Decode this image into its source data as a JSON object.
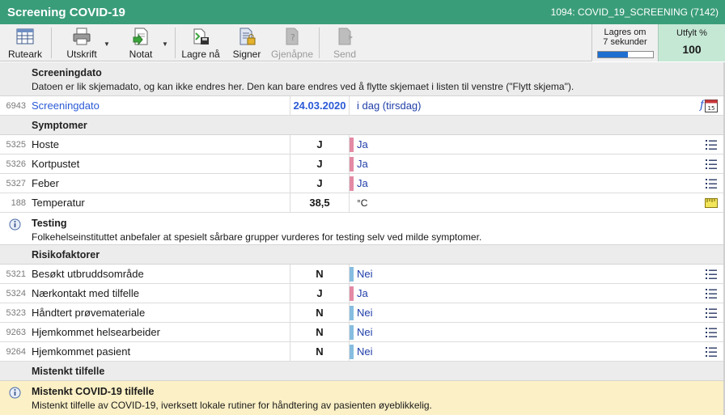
{
  "titlebar": {
    "title": "Screening COVID-19",
    "doc_id": "1094: COVID_19_SCREENING (7142)"
  },
  "toolbar": {
    "ruteark": "Ruteark",
    "utskrift": "Utskrift",
    "notat": "Notat",
    "lagre": "Lagre nå",
    "signer": "Signer",
    "gjenapne": "Gjenåpne",
    "send": "Send",
    "save_status": "Lagres om 7 sekunder",
    "save_progress": 0.55,
    "fill_label": "Utfylt %",
    "fill_value": "100"
  },
  "screeningdato": {
    "header": "Screeningdato",
    "desc": "Datoen er lik skjemadato, og kan ikke endres her.  Den kan bare endres ved å flytte skjemaet i listen til venstre (\"Flytt skjema\").",
    "num": "6943",
    "name": "Screeningdato",
    "value": "24.03.2020",
    "text": "i dag (tirsdag)",
    "calendar_day": "15"
  },
  "symptomer": {
    "header": "Symptomer",
    "rows": [
      {
        "num": "5325",
        "name": "Hoste",
        "code": "J",
        "text": "Ja"
      },
      {
        "num": "5326",
        "name": "Kortpustet",
        "code": "J",
        "text": "Ja"
      },
      {
        "num": "5327",
        "name": "Feber",
        "code": "J",
        "text": "Ja"
      },
      {
        "num": "188",
        "name": "Temperatur",
        "code": "38,5",
        "text": "°C"
      }
    ]
  },
  "testing": {
    "header": "Testing",
    "desc": "Folkehelseinstituttet anbefaler at spesielt sårbare grupper vurderes for testing selv ved milde symptomer."
  },
  "risikofaktorer": {
    "header": "Risikofaktorer",
    "rows": [
      {
        "num": "5321",
        "name": "Besøkt utbruddsområde",
        "code": "N",
        "text": "Nei"
      },
      {
        "num": "5324",
        "name": "Nærkontakt med tilfelle",
        "code": "J",
        "text": "Ja"
      },
      {
        "num": "5323",
        "name": "Håndtert prøvemateriale",
        "code": "N",
        "text": "Nei"
      },
      {
        "num": "9263",
        "name": "Hjemkommet helsearbeider",
        "code": "N",
        "text": "Nei"
      },
      {
        "num": "9264",
        "name": "Hjemkommet pasient",
        "code": "N",
        "text": "Nei"
      }
    ]
  },
  "mistenkt": {
    "header": "Mistenkt tilfelle",
    "alert_title": "Mistenkt COVID-19 tilfelle",
    "alert_desc": "Mistenkt tilfelle av COVID-19, iverksett lokale rutiner for håndtering av pasienten øyeblikkelig."
  },
  "colors": {
    "title_green": "#3a9d7a",
    "yes_mark": "#e38aa5",
    "no_mark": "#86bde0",
    "alert_bg": "#fbf0c6",
    "fill_bg": "#c5e8d5"
  }
}
